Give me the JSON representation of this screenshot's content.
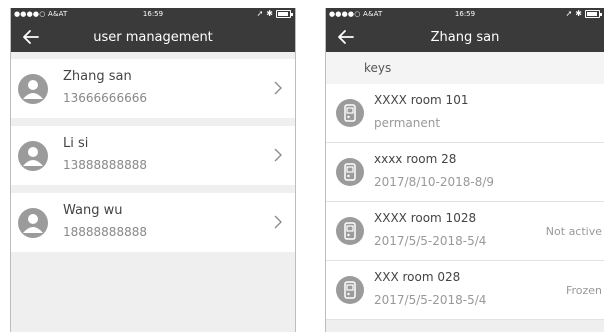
{
  "status_bar": {
    "carrier": "●●●●○ A&AT",
    "time": "16:59",
    "icons": [
      "wifi-icon",
      "location-icon",
      "bluetooth-icon",
      "battery-icon"
    ]
  },
  "left_screen": {
    "title": "user management",
    "users": [
      {
        "name": "Zhang san",
        "phone": "13666666666"
      },
      {
        "name": "Li si",
        "phone": "13888888888"
      },
      {
        "name": "Wang wu",
        "phone": "18888888888"
      }
    ]
  },
  "right_screen": {
    "title": "Zhang san",
    "section_label": "keys",
    "keys": [
      {
        "room": "XXXX room 101",
        "term": "permanent",
        "status": ""
      },
      {
        "room": "xxxx room 28",
        "term": "2017/8/10-2018-8/9",
        "status": ""
      },
      {
        "room": "XXXX room 1028",
        "term": "2017/5/5-2018-5/4",
        "status": "Not active"
      },
      {
        "room": "XXX room 028",
        "term": "2017/5/5-2018-5/4",
        "status": "Frozen"
      }
    ]
  },
  "colors": {
    "header_bg": "#3a3a3a",
    "page_bg": "#efefef",
    "icon_gray": "#9b9b9b"
  }
}
